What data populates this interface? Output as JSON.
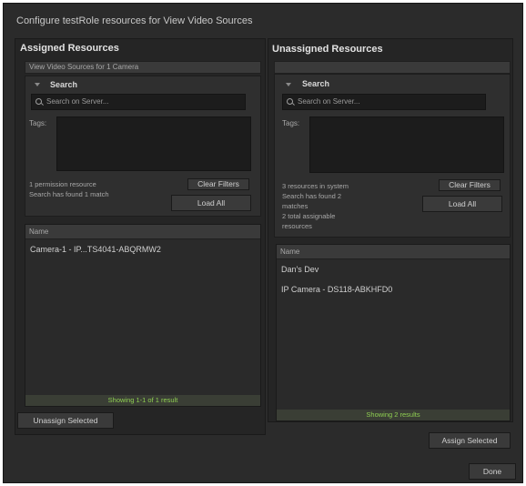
{
  "dialog": {
    "title": "Configure testRole resources for View Video Sources"
  },
  "assigned": {
    "heading": "Assigned Resources",
    "subheader": "View Video Sources for 1 Camera",
    "search_label": "Search",
    "search_placeholder": "Search on Server...",
    "tags_label": "Tags:",
    "info_lines": [
      "1 permission resource",
      "Search has found 1 match"
    ],
    "clear_filters": "Clear Filters",
    "load_all": "Load All",
    "column_name": "Name",
    "rows": [
      "Camera-1 - IP...TS4041-ABQRMW2"
    ],
    "status": "Showing 1-1 of 1 result",
    "action_button": "Unassign Selected"
  },
  "unassigned": {
    "heading": "Unassigned Resources",
    "search_label": "Search",
    "search_placeholder": "Search on Server...",
    "tags_label": "Tags:",
    "info_lines": [
      "3 resources in system",
      "Search has found 2",
      "matches",
      "2 total assignable",
      "resources"
    ],
    "clear_filters": "Clear Filters",
    "load_all": "Load All",
    "column_name": "Name",
    "rows": [
      "Dan's Dev",
      "IP Camera - DS118-ABKHFD0"
    ],
    "status": "Showing 2 results",
    "action_button": "Assign Selected"
  },
  "footer": {
    "done": "Done"
  },
  "colors": {
    "background": "#2b2b2b",
    "panel": "#252525",
    "status_text": "#8fcf52"
  }
}
